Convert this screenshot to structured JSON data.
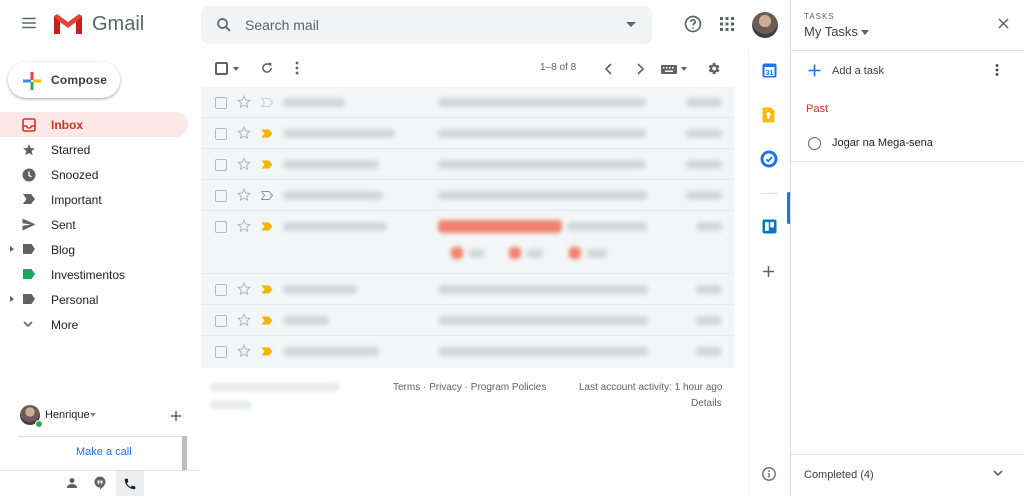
{
  "header": {
    "brand": "Gmail",
    "search_placeholder": "Search mail",
    "icons": [
      "menu-icon",
      "gmail-logo",
      "search-icon",
      "help-icon",
      "apps-icon"
    ]
  },
  "compose": {
    "label": "Compose"
  },
  "nav": {
    "items": [
      {
        "label": "Inbox",
        "icon": "inbox-icon",
        "active": true
      },
      {
        "label": "Starred",
        "icon": "star-icon"
      },
      {
        "label": "Snoozed",
        "icon": "clock-icon"
      },
      {
        "label": "Important",
        "icon": "important-icon"
      },
      {
        "label": "Sent",
        "icon": "send-icon"
      },
      {
        "label": "Blog",
        "icon": "label-icon",
        "expandable": true
      },
      {
        "label": "Investimentos",
        "icon": "label-icon",
        "color": "#16a766"
      },
      {
        "label": "Personal",
        "icon": "label-icon",
        "expandable": true
      },
      {
        "label": "More",
        "icon": "chevron-down-icon"
      }
    ]
  },
  "hangouts": {
    "user_name": "Henrique",
    "make_call": "Make a call"
  },
  "toolbar": {
    "pager": "1–8 of 8"
  },
  "footer": {
    "links": "Terms · Privacy · Program Policies",
    "last_activity": "Last account activity: 1 hour ago",
    "details": "Details"
  },
  "tasks": {
    "kicker": "TASKS",
    "list_name": "My Tasks",
    "add_task": "Add a task",
    "section": "Past",
    "items": [
      {
        "title": "Jogar na Mega-sena"
      }
    ],
    "completed": "Completed (4)"
  },
  "colors": {
    "accent_red": "#d93025",
    "active_bg": "#fce8e6",
    "link_blue": "#1a73e8",
    "important_yellow": "#f4b400"
  }
}
